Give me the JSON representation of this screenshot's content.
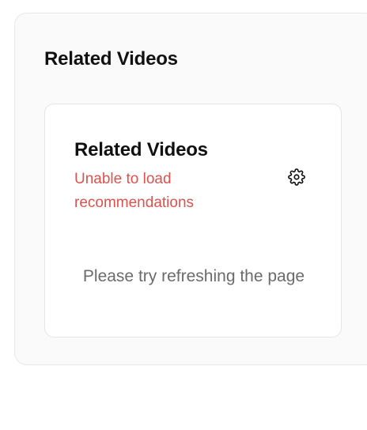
{
  "panel": {
    "title": "Related Videos"
  },
  "card": {
    "title": "Related Videos",
    "error": "Unable to load recommendations",
    "settings_icon": "gear-icon",
    "message": "Please try refreshing the page"
  },
  "colors": {
    "error": "#d9534f",
    "muted_text": "#6b6b6b",
    "panel_bg": "#fafafa",
    "card_bg": "#ffffff"
  }
}
